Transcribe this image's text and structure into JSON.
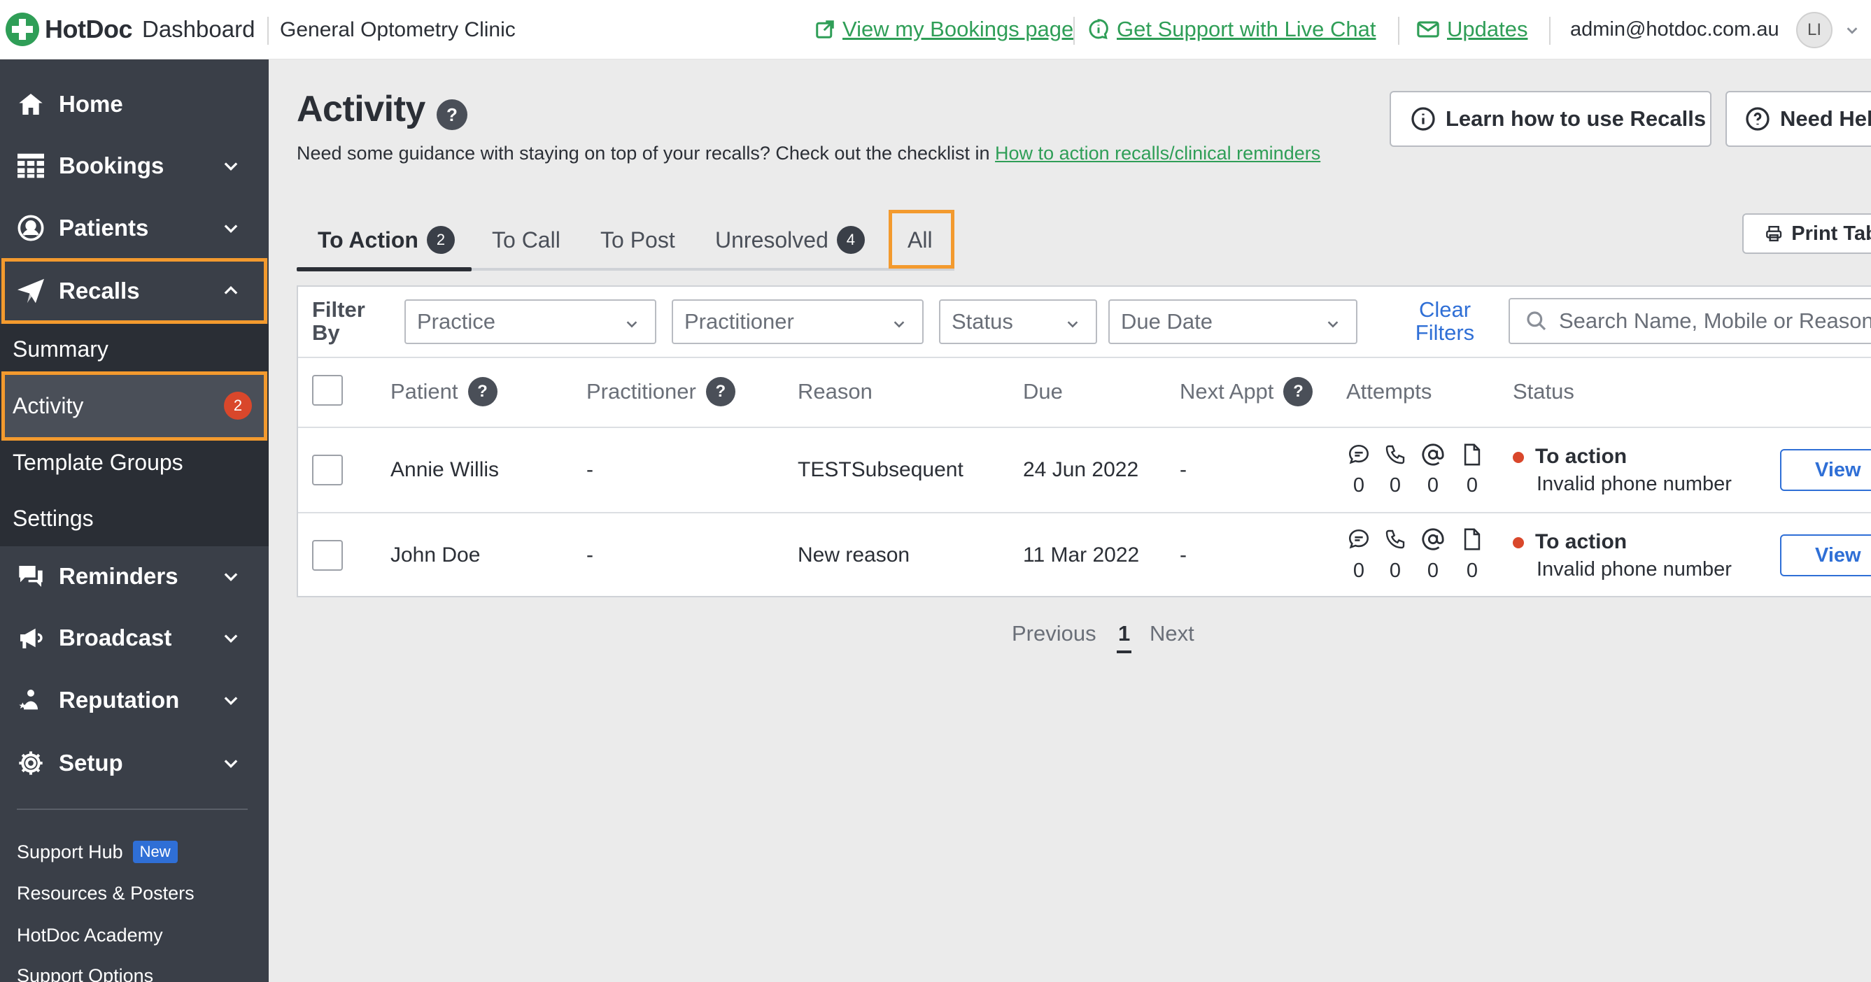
{
  "topbar": {
    "brand": "HotDoc",
    "dashboard": "Dashboard",
    "clinic": "General Optometry Clinic",
    "link_bookings": "View my Bookings page",
    "link_support": "Get Support with Live Chat",
    "link_updates": "Updates",
    "user_email": "admin@hotdoc.com.au",
    "avatar_initials": "LI"
  },
  "sidebar": {
    "items": [
      {
        "label": "Home",
        "icon": "home-icon"
      },
      {
        "label": "Bookings",
        "icon": "calendar-grid-icon"
      },
      {
        "label": "Patients",
        "icon": "user-circle-icon"
      },
      {
        "label": "Recalls",
        "icon": "paper-plane-icon"
      },
      {
        "label": "Reminders",
        "icon": "chat-bubbles-icon"
      },
      {
        "label": "Broadcast",
        "icon": "megaphone-icon"
      },
      {
        "label": "Reputation",
        "icon": "people-star-icon"
      },
      {
        "label": "Setup",
        "icon": "gear-icon"
      }
    ],
    "recalls_sub": [
      {
        "label": "Summary"
      },
      {
        "label": "Activity",
        "badge": "2"
      },
      {
        "label": "Template Groups"
      },
      {
        "label": "Settings"
      }
    ],
    "footer": {
      "support_hub": "Support Hub",
      "new_badge": "New",
      "resources": "Resources & Posters",
      "academy": "HotDoc Academy",
      "support_options": "Support Options"
    }
  },
  "main": {
    "title": "Activity",
    "help_glyph": "?",
    "guidance_text": "Need some guidance with staying on top of your recalls? Check out the checklist in ",
    "guidance_link": "How to action recalls/clinical reminders",
    "learn_button": "Learn how to use Recalls",
    "need_help_button": "Need Help?",
    "print_button": "Print Table",
    "tabs": [
      {
        "label": "To Action",
        "badge": "2"
      },
      {
        "label": "To Call"
      },
      {
        "label": "To Post"
      },
      {
        "label": "Unresolved",
        "badge": "4"
      },
      {
        "label": "All"
      }
    ],
    "filters": {
      "label": "Filter By",
      "practice": "Practice",
      "practitioner": "Practitioner",
      "status": "Status",
      "due_date": "Due Date",
      "clear": "Clear Filters",
      "search_placeholder": "Search Name, Mobile or Reason"
    },
    "columns": {
      "patient": "Patient",
      "practitioner": "Practitioner",
      "reason": "Reason",
      "due": "Due",
      "next_appt": "Next Appt",
      "attempts": "Attempts",
      "status": "Status"
    },
    "rows": [
      {
        "patient": "Annie Willis",
        "practitioner": "-",
        "reason": "TESTSubsequent",
        "due": "24 Jun 2022",
        "next_appt": "-",
        "attempts": [
          "0",
          "0",
          "0",
          "0"
        ],
        "status": "To action",
        "status_detail": "Invalid phone number",
        "action": "View"
      },
      {
        "patient": "John Doe",
        "practitioner": "-",
        "reason": "New reason",
        "due": "11 Mar 2022",
        "next_appt": "-",
        "attempts": [
          "0",
          "0",
          "0",
          "0"
        ],
        "status": "To action",
        "status_detail": "Invalid phone number",
        "action": "View"
      }
    ],
    "pagination": {
      "previous": "Previous",
      "current": "1",
      "next": "Next"
    }
  },
  "colors": {
    "brand_green": "#2f9e57",
    "sidebar_bg": "#3a3f48",
    "highlight_orange": "#f39a2e",
    "link_blue": "#2f6fd6",
    "alert_red": "#d9472b"
  }
}
